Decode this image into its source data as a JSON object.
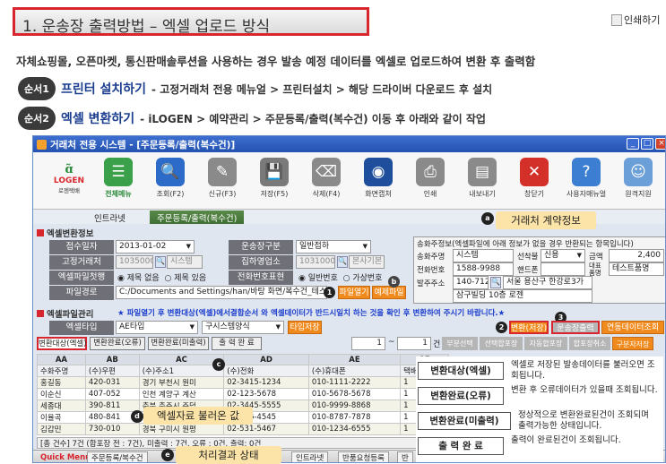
{
  "page": {
    "title": "1. 운송장 출력방법 – 엑셀 업로드 방식",
    "print_alt": "인쇄하기",
    "description": "자체쇼핑몰, 오픈마켓, 통신판매솔루션을 사용하는 경우 발송 예정 데이터를 엑셀로 업로드하여 변환 후 출력함",
    "steps": [
      {
        "badge": "순서1",
        "title": "프린터 설치하기",
        "path": "- 고정거래처 전용 메뉴얼 > 프린터설치 > 해당 드라이버 다운로드 후 설치"
      },
      {
        "badge": "순서2",
        "title": "엑셀 변환하기",
        "path": "- iLOGEN > 예약관리 > 주문등록/출력(복수건) 이동 후 아래와 같이 작업"
      }
    ]
  },
  "window": {
    "title": "거래처 전용 시스템 - [주문등록/출력(복수건)]",
    "logo_text": "로젠택배",
    "toolbar": [
      {
        "label": "전체메뉴",
        "icon": "menu-icon",
        "color": "#3aa04a"
      },
      {
        "label": "조회(F2)",
        "icon": "search-icon",
        "color": "#2d6bc8"
      },
      {
        "label": "신규(F3)",
        "icon": "new-icon",
        "color": "#8a8a8a"
      },
      {
        "label": "저장(F5)",
        "icon": "save-icon",
        "color": "#7a7a7a"
      },
      {
        "label": "삭제(F4)",
        "icon": "delete-icon",
        "color": "#8a8a8a"
      },
      {
        "label": "화면캡쳐",
        "icon": "capture-icon",
        "color": "#1f4f9c"
      },
      {
        "label": "인쇄",
        "icon": "print-icon",
        "color": "#8a8a8a"
      },
      {
        "label": "내보내기",
        "icon": "export-icon",
        "color": "#8a8a8a"
      },
      {
        "label": "창닫기",
        "icon": "close-window-icon",
        "color": "#d3302a"
      },
      {
        "label": "사용자매뉴얼",
        "icon": "manual-icon",
        "color": "#3c7fd2"
      },
      {
        "label": "원격지원",
        "icon": "remote-support-icon",
        "color": "#6a9fd8"
      }
    ],
    "tabs": [
      "인트라넷",
      "주문등록/출력(복수건)"
    ],
    "section1_title": "엑셀변환정보",
    "form": {
      "receipt_date_label": "접수일자",
      "receipt_date": "2013-01-02",
      "fare_type_label": "운송장구분",
      "fare_type": "일반접하",
      "client_label": "고정거래처",
      "client_code": "10350007",
      "client_name": "시스템",
      "branch_label": "집하영업소",
      "branch_code": "10310000",
      "branch_name": "본사기본",
      "excel_format_label": "엑셀파일첫행",
      "excel_opt1": "제목 없음",
      "excel_opt2": "제목 있음",
      "phone_type_label": "전화번호표현",
      "phone_opt1": "일반번호",
      "phone_opt2": "가상번호",
      "filepath_label": "파일경로",
      "filepath": "C:/Documents and Settings/han/바탕 화면/복수건_테스트.xls",
      "btn_open": "파일열기",
      "btn_excel": "예제파일"
    },
    "info_panel": {
      "header": "송화주정보(엑셀파일에 아래 정보가 없을 경우 반환되는 항목입니다)",
      "sender_label": "송화주명",
      "sender": "시스템",
      "pay_label": "선착불",
      "pay": "신용",
      "fee_label": "금액",
      "fee": "2,400",
      "phone_label": "전화번호",
      "phone": "1588-9988",
      "mobile_label": "핸드폰",
      "item_label": "대표품명",
      "item": "테스트품명",
      "addr_label": "발주주소",
      "zip": "140-712",
      "addr1": "서울 용산구 한강로3가",
      "addr2": "삼구빌딩 10층 로젠"
    },
    "section2_title": "엑셀파일관리",
    "notice": "★ 파일열기 후 변환대상(엑셀)에서결합순서 와 엑셀데이터가 반드시일치 하는 것을 확인 후 변환하여 주시기 바랍니다.★",
    "excel_type_label": "엑셀타입",
    "excel_type": "AE타입",
    "excel_style": "구시스템양식",
    "btn_type_save": "타입저장",
    "btn_convert": "변환(저장)",
    "btn_print": "운송장출력",
    "btn_link": "연동데이터조회",
    "result_tabs": [
      "변환대상(엑셀)",
      "변환완료(오류)",
      "변환완료(미출력)",
      "출 력 완 료"
    ],
    "page_from": "1",
    "page_to": "1",
    "page_unit": "건",
    "sub_buttons": [
      "부분선택",
      "선택합포장",
      "자동합포장",
      "합포장취소",
      "구분자저장"
    ],
    "grid_cols": [
      "AA",
      "AB",
      "AC",
      "AD",
      "AE",
      "AF"
    ],
    "grid_head": [
      "수화주명",
      "(수)우편",
      "(수)주소1",
      "(수)전화",
      "(수)휴대폰",
      "택배수량"
    ],
    "grid_rows": [
      [
        "홍길동",
        "420-031",
        "경기 부천시 원미",
        "02-3415-1234",
        "010-1111-2222",
        "1"
      ],
      [
        "이순신",
        "407-052",
        "인천 계양구 계산",
        "02-123-5678",
        "010-5678-5678",
        "1"
      ],
      [
        "세종대",
        "390-811",
        "충북 충주시 주덕",
        "02-3445-5555",
        "010-9999-8868",
        "1"
      ],
      [
        "이율곡",
        "480-841",
        "경기 의정부시 가",
        "02-456-4545",
        "010-8787-7878",
        "1"
      ],
      [
        "김갑민",
        "730-010",
        "경북 구미시 원평",
        "02-531-5467",
        "010-1234-6555",
        "1"
      ]
    ],
    "status_bar": "[총 건수] 7건 (합포장 전 : 7건), 미출력 : 7건, 오류 : 0건, 출력: 0건",
    "bottom_tabs": [
      "Quick Menu",
      "주문등록/복수건",
      "인트라넷",
      "반품요청등록",
      "반"
    ]
  },
  "annotations": {
    "a": "거래처 계약정보",
    "c_marker": "c",
    "d": "엑셀자료 불러온 값",
    "e": "처리결과 상태"
  },
  "legend": [
    {
      "tag": "변환대상(엑셀)",
      "desc": "엑셀로 저장된 발송데이터를 불러오면 조회됩니다."
    },
    {
      "tag": "변환완료(오류)",
      "desc": "변환 후 오류데이터가 있을때 조회됩니다."
    },
    {
      "tag": "변환완료(미출력)",
      "desc": "정상적으로 변환완료된건이 조회되며 출력가능한 상태입니다."
    },
    {
      "tag": "출 력 완 료",
      "desc": "출력이 완료된건이 조회됩니다."
    }
  ]
}
